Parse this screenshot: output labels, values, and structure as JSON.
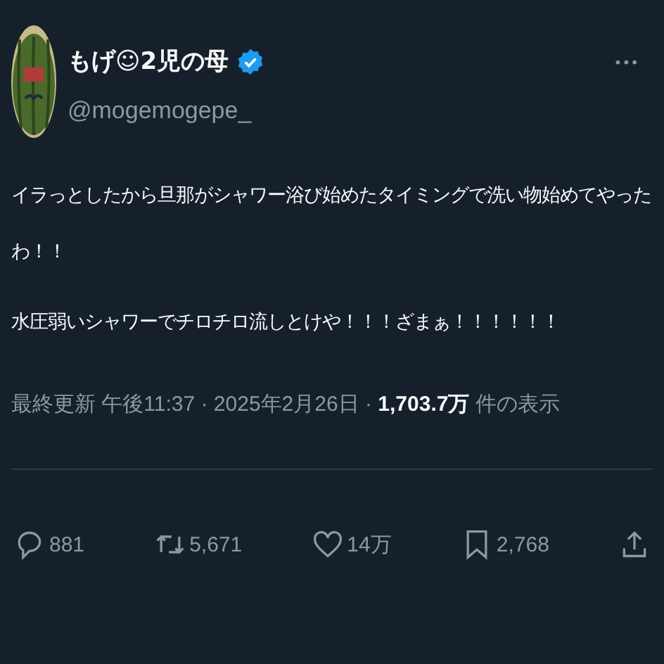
{
  "author": {
    "name": "もげ☺2児の母",
    "verified": true,
    "handle": "@mogemogepe_"
  },
  "menu": "•••",
  "body": [
    "イラっとしたから旦那がシャワー浴び始めたタイミングで洗い物始めてやったわ！！",
    "水圧弱いシャワーでチロチロ流しとけや！！！ざまぁ！！！！！！"
  ],
  "meta": {
    "prefix": "最終更新 午後11:37 · 2025年2月26日 · ",
    "views": "1,703.7万",
    "suffix": " 件の表示"
  },
  "actions": [
    {
      "kind": "reply",
      "count": "881"
    },
    {
      "kind": "repost",
      "count": "5,671"
    },
    {
      "kind": "like",
      "count": "14万"
    },
    {
      "kind": "bookmark",
      "count": "2,768"
    },
    {
      "kind": "share"
    }
  ]
}
